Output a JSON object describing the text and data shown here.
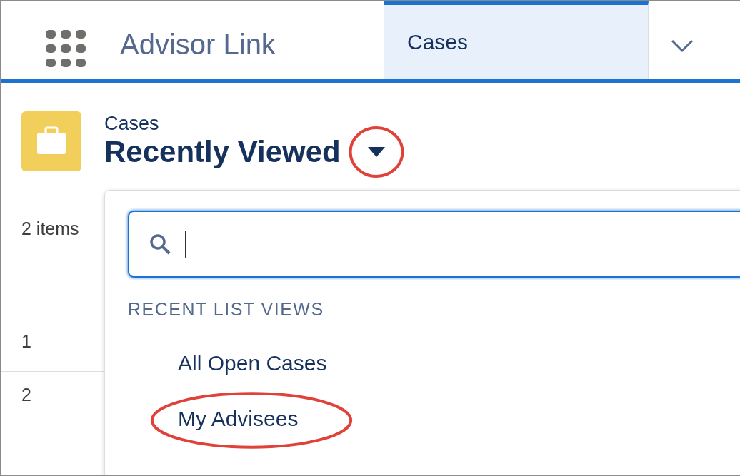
{
  "app": {
    "name": "Advisor Link"
  },
  "tabs": [
    {
      "label": "Cases",
      "selected": true
    }
  ],
  "header": {
    "object": "Cases",
    "view": "Recently Viewed",
    "highlighted": true
  },
  "list": {
    "count": "2 items",
    "rows": [
      {
        "number": "1"
      },
      {
        "number": "2"
      }
    ]
  },
  "dropdown": {
    "section": "RECENT LIST VIEWS",
    "items": [
      {
        "label": "All Open Cases",
        "highlighted": false
      },
      {
        "label": "My Advisees",
        "highlighted": true
      }
    ]
  }
}
